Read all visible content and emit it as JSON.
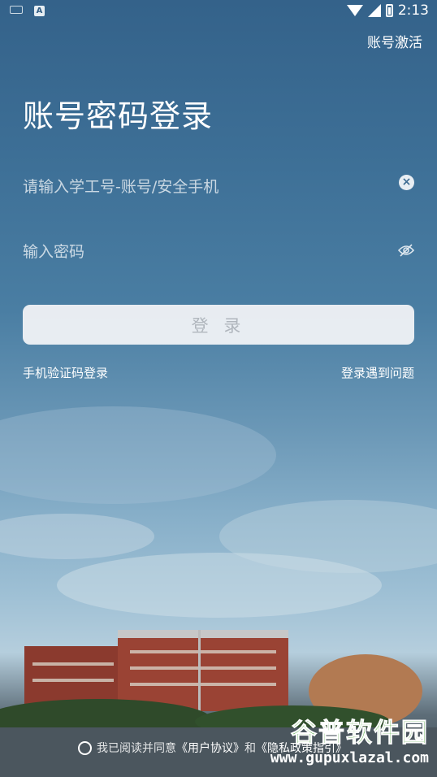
{
  "status_bar": {
    "time": "2:13"
  },
  "header": {
    "activate_link": "账号激活"
  },
  "title": "账号密码登录",
  "account_field": {
    "placeholder": "请输入学工号-账号/安全手机"
  },
  "password_field": {
    "placeholder": "输入密码"
  },
  "login_button": "登 录",
  "links": {
    "sms_login": "手机验证码登录",
    "login_help": "登录遇到问题"
  },
  "agreement": {
    "prefix": "我已阅读并同意",
    "user_agreement": "《用户协议》",
    "conjunction": "和",
    "privacy_policy": "《隐私政策指引》"
  },
  "watermark": {
    "title": "谷普软件园",
    "url": "www.gupuxlazal.com"
  },
  "colors": {
    "sky_top": "#34628a",
    "button_bg": "#f0f2f5",
    "button_text": "#b0b6bd",
    "watermark_green": "#4aa53a"
  },
  "icons": [
    "keyboard-icon",
    "a-icon",
    "wifi-icon",
    "signal-icon",
    "battery-icon",
    "clear-icon",
    "eye-off-icon",
    "radio-icon"
  ]
}
